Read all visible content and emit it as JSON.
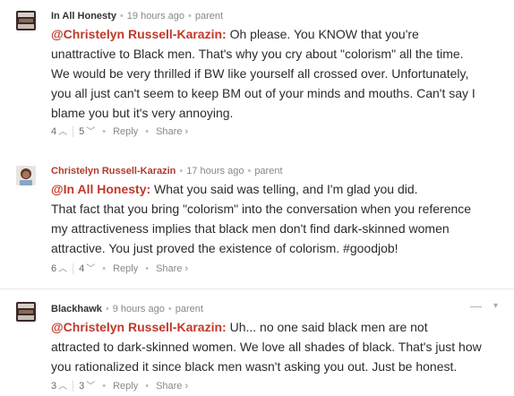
{
  "comments": [
    {
      "author": "In All Honesty",
      "time": "19 hours ago",
      "parent_label": "parent",
      "mention": "@Christelyn Russell-Karazin:",
      "lines": [
        " Oh please. You KNOW that you're",
        "unattractive to Black men. That's why you cry about \"colorism\" all the time.",
        "We would be very thrilled if BW like yourself all crossed over. Unfortunately,",
        "you all just can't seem to keep BM out of your minds and mouths. Can't say I",
        "blame you but it's very annoying."
      ],
      "upvotes": "4",
      "downvotes": "5",
      "reply_label": "Reply",
      "share_label": "Share ›"
    },
    {
      "author": "Christelyn Russell-Karazin",
      "time": "17 hours ago",
      "parent_label": "parent",
      "mention": "@In All Honesty:",
      "lines": [
        " What you said was telling, and I'm glad you did.",
        "That fact that you bring \"colorism\" into the conversation when you reference",
        "my attractiveness implies that black men don't find dark-skinned women",
        "attractive. You just proved the existence of colorism. #goodjob!"
      ],
      "upvotes": "6",
      "downvotes": "4",
      "reply_label": "Reply",
      "share_label": "Share ›"
    },
    {
      "author": "Blackhawk",
      "time": "9 hours ago",
      "parent_label": "parent",
      "mention": "@Christelyn Russell-Karazin:",
      "lines": [
        " Uh... no one said black men are not",
        "attracted to dark-skinned women. We love all shades of black. That's just how",
        "you rationalized it since black men wasn't asking you out. Just be honest."
      ],
      "upvotes": "3",
      "downvotes": "3",
      "reply_label": "Reply",
      "share_label": "Share ›",
      "collapse_label": "—",
      "menu_label": "▾"
    }
  ],
  "icons": {
    "upvote": "up-arrow-icon",
    "downvote": "down-arrow-icon"
  }
}
